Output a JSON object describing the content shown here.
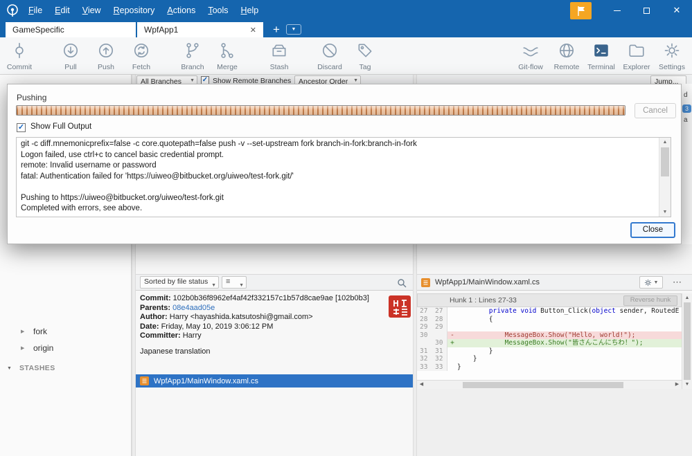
{
  "colors": {
    "titlebar": "#1565ae",
    "selection": "#2e73c5",
    "accent_orange": "#f5a623",
    "progress_copper": "#c07b4a",
    "badge_blue": "#4a90d9"
  },
  "titlebar": {
    "menus": [
      "File",
      "Edit",
      "View",
      "Repository",
      "Actions",
      "Tools",
      "Help"
    ],
    "close_glyph": "✕"
  },
  "tabs": {
    "tab1": "GameSpecific",
    "tab2": "WpfApp1",
    "close_glyph": "✕",
    "new_tab_glyph": "+",
    "dd_glyph": "▼"
  },
  "toolbar": {
    "left": [
      {
        "label": "Commit"
      },
      {
        "label": "Pull"
      },
      {
        "label": "Push"
      },
      {
        "label": "Fetch"
      },
      {
        "label": "Branch"
      },
      {
        "label": "Merge"
      },
      {
        "label": "Stash"
      },
      {
        "label": "Discard"
      },
      {
        "label": "Tag"
      }
    ],
    "right": [
      {
        "label": "Git-flow"
      },
      {
        "label": "Remote"
      },
      {
        "label": "Terminal"
      },
      {
        "label": "Explorer"
      },
      {
        "label": "Settings"
      }
    ]
  },
  "branch_bar": {
    "all_branches": "All Branches",
    "show_remote_label": "Show Remote Branches",
    "order": "Ancestor Order",
    "jump": "Jump...",
    "check_glyph": "✓"
  },
  "graph_edge": {
    "frag1": "d",
    "badge": "3",
    "frag2": "a"
  },
  "sidebar": {
    "remotes": [
      {
        "label": "fork"
      },
      {
        "label": "origin"
      }
    ],
    "stashes_label": "STASHES",
    "collapsed_glyph": "▶",
    "expanded_glyph": "▼"
  },
  "dialog": {
    "title": "Pushing",
    "cancel_label": "Cancel",
    "show_full_output_label": "Show Full Output",
    "check_glyph": "✓",
    "close_label": "Close",
    "output_lines": [
      "git -c diff.mnemonicprefix=false -c core.quotepath=false push -v --set-upstream fork branch-in-fork:branch-in-fork",
      "Logon failed, use ctrl+c to cancel basic credential prompt.",
      "remote: Invalid username or password",
      "fatal: Authentication failed for 'https://uiweo@bitbucket.org/uiweo/test-fork.git/'",
      "",
      "Pushing to https://uiweo@bitbucket.org/uiweo/test-fork.git",
      "Completed with errors, see above."
    ]
  },
  "commit_panel": {
    "sort_dropdown": "Sorted by file status",
    "list_icon_glyph": "≡",
    "info": {
      "commit_label": "Commit:",
      "commit_value": "102b0b36f8962ef4af42f332157c1b57d8cae9ae [102b0b3]",
      "parents_label": "Parents:",
      "parents_value": "08e4aad05e",
      "author_label": "Author:",
      "author_value": "Harry <hayashida.katsutoshi@gmail.com>",
      "date_label": "Date:",
      "date_value": "Friday, May 10, 2019 3:06:12 PM",
      "committer_label": "Committer:",
      "committer_value": "Harry",
      "message": "Japanese translation"
    },
    "selected_file": "WpfApp1/MainWindow.xaml.cs"
  },
  "diff_panel": {
    "file_title": "WpfApp1/MainWindow.xaml.cs",
    "hunk_label": "Hunk 1 : Lines 27-33",
    "reverse_hunk_label": "Reverse hunk",
    "dots_glyph": "⋯",
    "rows": [
      {
        "old": "27",
        "new": "27",
        "marker": "",
        "c1": "        ",
        "k1": "private void",
        "c2": " Button_Click(",
        "k2": "object",
        "c3": " sender, RoutedE"
      },
      {
        "old": "28",
        "new": "28",
        "marker": "",
        "code": "        {"
      },
      {
        "old": "29",
        "new": "29",
        "marker": "",
        "code": ""
      },
      {
        "old": "30",
        "new": "",
        "marker": "-",
        "code": "            MessageBox.Show(\"Hello, world!\");"
      },
      {
        "old": "",
        "new": "30",
        "marker": "+",
        "code": "            MessageBox.Show(\"皆さんこんにちわ！\");"
      },
      {
        "old": "31",
        "new": "31",
        "marker": "",
        "code": "        }"
      },
      {
        "old": "32",
        "new": "32",
        "marker": "",
        "code": "    }"
      },
      {
        "old": "33",
        "new": "33",
        "marker": "",
        "code": "}"
      }
    ]
  }
}
